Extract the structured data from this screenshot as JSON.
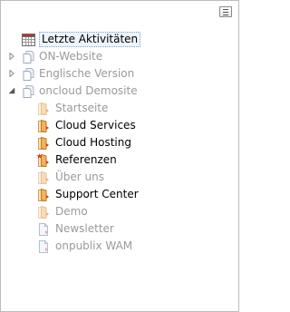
{
  "toolbar": {
    "menu_icon": "list-menu-icon"
  },
  "tree": {
    "recent": {
      "label": "Letzte Aktivitäten",
      "icon": "calendar-icon"
    },
    "sites": [
      {
        "label": "ON-Website",
        "state": "collapsed"
      },
      {
        "label": "Englische Version",
        "state": "collapsed"
      },
      {
        "label": "oncloud Demosite",
        "state": "expanded"
      }
    ],
    "children": [
      {
        "label": "Startseite",
        "style": "grey",
        "icon": "folder-doc-icon"
      },
      {
        "label": "Cloud Services",
        "style": "black",
        "icon": "folder-doc-icon"
      },
      {
        "label": "Cloud Hosting",
        "style": "black",
        "icon": "folder-doc-icon"
      },
      {
        "label": "Referenzen",
        "style": "black",
        "icon": "folder-star-icon"
      },
      {
        "label": "Über uns",
        "style": "grey",
        "icon": "folder-doc-icon"
      },
      {
        "label": "Support Center",
        "style": "black",
        "icon": "folder-doc-icon"
      },
      {
        "label": "Demo",
        "style": "grey",
        "icon": "folder-doc-icon"
      },
      {
        "label": "Newsletter",
        "style": "grey",
        "icon": "page-icon"
      },
      {
        "label": "onpublix WAM",
        "style": "grey",
        "icon": "page-icon"
      }
    ]
  },
  "colors": {
    "selected_border": "#7da2ce",
    "active_text": "#000000",
    "inactive_text": "#9a9a9a",
    "folder": "#f0b45a",
    "folder_faded": "#f6d8ab"
  }
}
